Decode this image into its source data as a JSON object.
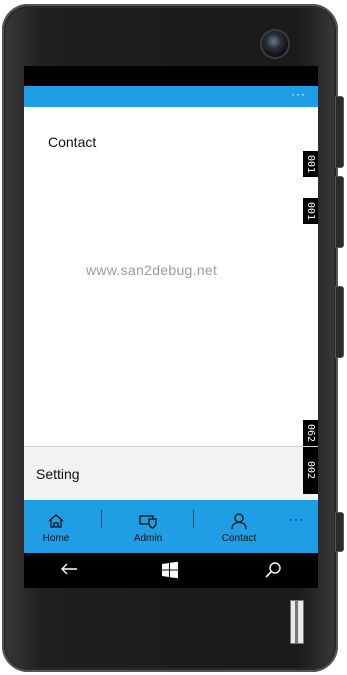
{
  "device": {
    "frame_color": "#1f1f1f"
  },
  "app": {
    "accent": "#1f9ee6",
    "more_label": "···"
  },
  "content": {
    "title": "Contact",
    "watermark": "www.san2debug.net"
  },
  "markers": {
    "top_1": "001",
    "top_2": "001",
    "bottom_1": "062",
    "bottom_2": "002"
  },
  "pane": {
    "item_label": "Setting"
  },
  "nav": {
    "items": [
      {
        "label": "Home",
        "icon": "home-icon"
      },
      {
        "label": "Admin",
        "icon": "admin-shield-icon"
      },
      {
        "label": "Contact",
        "icon": "person-icon"
      }
    ],
    "more_label": "···"
  },
  "system": {
    "back_icon": "back-arrow-icon",
    "start_icon": "windows-logo-icon",
    "search_icon": "search-icon"
  }
}
